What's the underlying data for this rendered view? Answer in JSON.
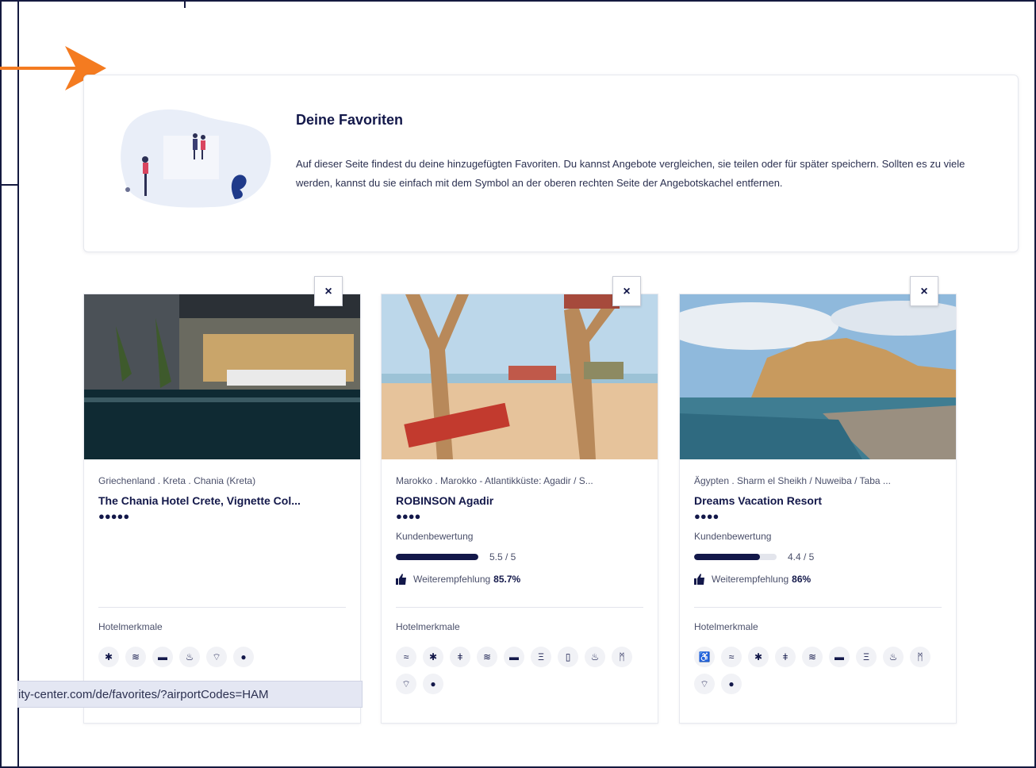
{
  "favorites": {
    "title": "Deine Favoriten",
    "description": "Auf dieser Seite findest du deine hinzugefügten Favoriten. Du kannst Angebote vergleichen, sie teilen oder für später speichern. Sollten es zu viele werden, kannst du sie einfach mit dem Symbol an der oberen rechten Seite der Angebotskachel entfernen."
  },
  "close_label": "×",
  "hotels": [
    {
      "location": "Griechenland . Kreta . Chania (Kreta)",
      "name": "The Chania Hotel Crete, Vignette Col...",
      "stars": "●●●●●",
      "rating_label": "",
      "rating_value": "",
      "rating_fraction": 0,
      "recommend_label": "",
      "recommend_value": "",
      "features_label": "Hotelmerkmale",
      "features": [
        "palm-icon",
        "beach-icon",
        "pool-icon",
        "spa-icon",
        "wifi-icon",
        "parking-icon"
      ]
    },
    {
      "location": "Marokko . Marokko - Atlantikküste: Agadir / S...",
      "name": "ROBINSON Agadir",
      "stars": "●●●●",
      "rating_label": "Kundenbewertung",
      "rating_value": "5.5 / 5",
      "rating_fraction": 1.0,
      "recommend_label": "Weiterempfehlung",
      "recommend_value": "85.7%",
      "features_label": "Hotelmerkmale",
      "features": [
        "swim-icon",
        "palm-icon",
        "restaurant-icon",
        "beach-icon",
        "pool-icon",
        "sport-icon",
        "fitness-icon",
        "spa-icon",
        "family-icon",
        "wifi-icon",
        "parking-icon"
      ]
    },
    {
      "location": "Ägypten . Sharm el Sheikh / Nuweiba / Taba ...",
      "name": "Dreams Vacation Resort",
      "stars": "●●●●",
      "rating_label": "Kundenbewertung",
      "rating_value": "4.4 / 5",
      "rating_fraction": 0.8,
      "recommend_label": "Weiterempfehlung",
      "recommend_value": "86%",
      "features_label": "Hotelmerkmale",
      "features": [
        "accessible-icon",
        "swim-icon",
        "palm-icon",
        "restaurant-icon",
        "beach-icon",
        "pool-icon",
        "sport-icon",
        "spa-icon",
        "family-icon",
        "wifi-icon",
        "parking-icon"
      ]
    }
  ],
  "status_url": "ity-center.com/de/favorites/?airportCodes=HAM",
  "colors": {
    "accent": "#f47b20",
    "navy": "#13184a"
  }
}
